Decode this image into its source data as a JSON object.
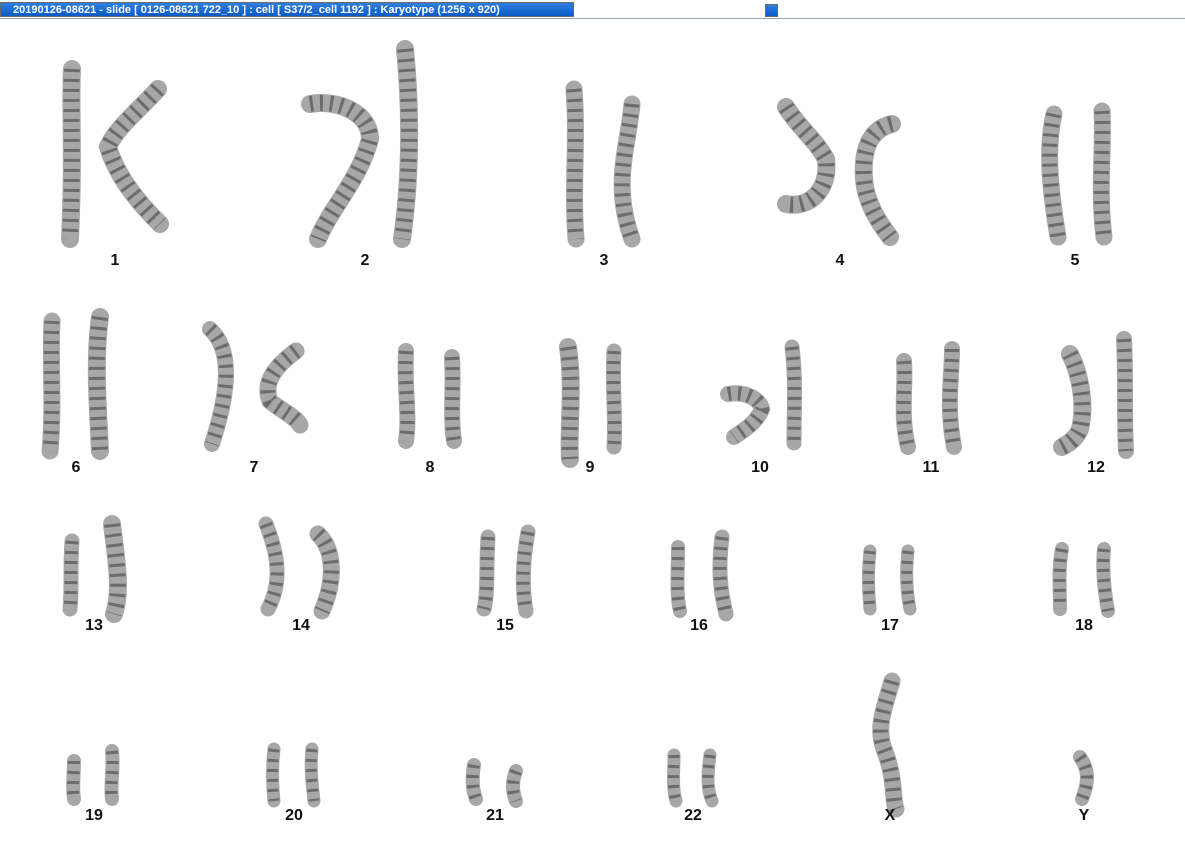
{
  "window": {
    "title": "20190126-08621 - slide [ 0126-08621 722_10 ] : cell [ S37/2_cell 1192 ] : Karyotype  (1256 x 920)"
  },
  "colors": {
    "title_bar": "#0b5bc7",
    "title_text": "#ffffff",
    "chromosome": "#8a8a8a",
    "band": "#3c3c3c",
    "label": "#111111"
  },
  "karyogram": {
    "chromosomes": [
      {
        "label": "1"
      },
      {
        "label": "2"
      },
      {
        "label": "3"
      },
      {
        "label": "4"
      },
      {
        "label": "5"
      },
      {
        "label": "6"
      },
      {
        "label": "7"
      },
      {
        "label": "8"
      },
      {
        "label": "9"
      },
      {
        "label": "10"
      },
      {
        "label": "11"
      },
      {
        "label": "12"
      },
      {
        "label": "13"
      },
      {
        "label": "14"
      },
      {
        "label": "15"
      },
      {
        "label": "16"
      },
      {
        "label": "17"
      },
      {
        "label": "18"
      },
      {
        "label": "19"
      },
      {
        "label": "20"
      },
      {
        "label": "21"
      },
      {
        "label": "22"
      },
      {
        "label": "X"
      },
      {
        "label": "Y"
      }
    ]
  }
}
